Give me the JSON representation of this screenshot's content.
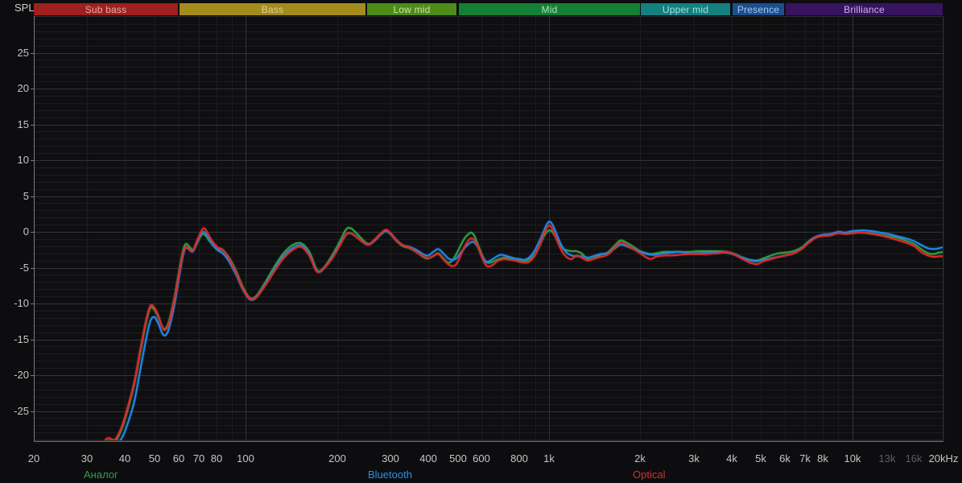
{
  "header": {
    "spl_label": "SPL"
  },
  "bands": [
    {
      "label": "Sub bass",
      "f_start": 20,
      "f_end": 60,
      "color": "#a01f1f",
      "text_color": "#e4b2ad"
    },
    {
      "label": "Bass",
      "f_start": 60,
      "f_end": 250,
      "color": "#a38c1c",
      "text_color": "#ded29b"
    },
    {
      "label": "Low mid",
      "f_start": 250,
      "f_end": 500,
      "color": "#4e8c18",
      "text_color": "#cfe3a8"
    },
    {
      "label": "Mid",
      "f_start": 500,
      "f_end": 2000,
      "color": "#148035",
      "text_color": "#b5dfc2"
    },
    {
      "label": "Upper mid",
      "f_start": 2000,
      "f_end": 4000,
      "color": "#148080",
      "text_color": "#abdcdc"
    },
    {
      "label": "Presence",
      "f_start": 4000,
      "f_end": 6000,
      "color": "#1b4f8f",
      "text_color": "#aac7e9"
    },
    {
      "label": "Brilliance",
      "f_start": 6000,
      "f_end": 20000,
      "color": "#38135f",
      "text_color": "#c9b3e4"
    }
  ],
  "axes": {
    "y_unit": "dB",
    "y_ticks": [
      25,
      20,
      15,
      10,
      5,
      0,
      -5,
      -10,
      -15,
      -20,
      -25
    ],
    "x_ticks": [
      {
        "f": 20,
        "label": "20"
      },
      {
        "f": 30,
        "label": "30"
      },
      {
        "f": 40,
        "label": "40"
      },
      {
        "f": 50,
        "label": "50"
      },
      {
        "f": 60,
        "label": "60"
      },
      {
        "f": 70,
        "label": "70"
      },
      {
        "f": 80,
        "label": "80"
      },
      {
        "f": 100,
        "label": "100"
      },
      {
        "f": 200,
        "label": "200"
      },
      {
        "f": 300,
        "label": "300"
      },
      {
        "f": 400,
        "label": "400"
      },
      {
        "f": 500,
        "label": "500"
      },
      {
        "f": 600,
        "label": "600"
      },
      {
        "f": 800,
        "label": "800"
      },
      {
        "f": 1000,
        "label": "1k"
      },
      {
        "f": 2000,
        "label": "2k"
      },
      {
        "f": 3000,
        "label": "3k"
      },
      {
        "f": 4000,
        "label": "4k"
      },
      {
        "f": 5000,
        "label": "5k"
      },
      {
        "f": 6000,
        "label": "6k"
      },
      {
        "f": 7000,
        "label": "7k"
      },
      {
        "f": 8000,
        "label": "8k"
      },
      {
        "f": 10000,
        "label": "10k"
      },
      {
        "f": 13000,
        "label": "13k",
        "dim": true
      },
      {
        "f": 16000,
        "label": "16k",
        "dim": true
      },
      {
        "f": 20000,
        "label": "20kHz"
      }
    ]
  },
  "legend": [
    {
      "label": "Аналог",
      "color": "#33a03e"
    },
    {
      "label": "Bluetooth",
      "color": "#2b8fe8"
    },
    {
      "label": "Optical",
      "color": "#d3302f"
    }
  ],
  "chart_data": {
    "type": "line",
    "title": "",
    "ylabel": "SPL (dB)",
    "x_unit": "Hz",
    "xscale": "log",
    "xlim": [
      20,
      20000
    ],
    "ylim": [
      -29.3,
      29.5
    ],
    "grid": true,
    "legend_position": "bottom",
    "x": [
      33,
      35,
      37,
      39,
      41,
      43,
      45,
      47,
      48.5,
      50,
      51.5,
      53.5,
      55.5,
      58,
      60,
      62,
      63.5,
      65.5,
      67,
      69,
      71,
      72.5,
      74,
      76,
      78.5,
      81,
      84,
      88,
      93,
      98,
      103,
      108,
      115,
      123,
      132,
      142,
      152,
      162,
      170,
      175,
      182,
      192,
      203,
      214,
      222,
      232,
      243,
      254,
      266,
      278,
      290,
      302,
      315,
      330,
      348,
      368,
      388,
      400,
      418,
      432,
      448,
      465,
      480,
      495,
      510,
      525,
      540,
      555,
      568,
      582,
      598,
      612,
      626,
      640,
      658,
      675,
      695,
      715,
      740,
      770,
      800,
      830,
      860,
      895,
      925,
      955,
      980,
      1000,
      1020,
      1045,
      1075,
      1110,
      1150,
      1190,
      1230,
      1280,
      1340,
      1400,
      1480,
      1560,
      1650,
      1720,
      1800,
      1900,
      2000,
      2100,
      2170,
      2250,
      2400,
      2550,
      2700,
      2900,
      3100,
      3300,
      3600,
      3850,
      4100,
      4350,
      4600,
      4850,
      5100,
      5400,
      5700,
      6000,
      6400,
      6800,
      7200,
      7600,
      8000,
      8500,
      9000,
      9500,
      10000,
      10800,
      11600,
      12400,
      13200,
      14000,
      15000,
      16000,
      17000,
      17800,
      18600,
      19300,
      20000
    ],
    "series": [
      {
        "name": "Аналог",
        "color": "#2da03c",
        "values": [
          -31,
          -29.2,
          -29.3,
          -27.5,
          -24.5,
          -21,
          -16.5,
          -12.5,
          -10.6,
          -10.9,
          -11.9,
          -13.5,
          -12.8,
          -9.5,
          -6.0,
          -2.8,
          -1.7,
          -2.2,
          -2.5,
          -1.6,
          -0.6,
          -0.3,
          -0.6,
          -1.3,
          -2.0,
          -2.4,
          -2.6,
          -3.6,
          -5.5,
          -7.8,
          -9.2,
          -9.0,
          -7.3,
          -5.2,
          -3.2,
          -1.9,
          -1.6,
          -2.8,
          -5.0,
          -5.5,
          -4.9,
          -3.4,
          -1.6,
          0.3,
          0.5,
          -0.2,
          -1.1,
          -1.7,
          -1.2,
          -0.4,
          0.2,
          -0.4,
          -1.3,
          -2.0,
          -2.3,
          -2.9,
          -3.6,
          -3.7,
          -3.3,
          -3.0,
          -3.7,
          -4.3,
          -4.0,
          -3.1,
          -2.0,
          -1.0,
          -0.4,
          -0.1,
          -0.6,
          -1.7,
          -3.0,
          -3.9,
          -4.3,
          -4.3,
          -4.1,
          -3.9,
          -3.7,
          -3.6,
          -3.7,
          -3.9,
          -4.0,
          -4.1,
          -3.9,
          -3.2,
          -2.2,
          -0.9,
          -0.1,
          0.2,
          0.1,
          -0.5,
          -1.4,
          -2.3,
          -2.6,
          -2.7,
          -2.7,
          -3.0,
          -3.8,
          -3.7,
          -3.2,
          -2.9,
          -1.9,
          -1.2,
          -1.5,
          -2.1,
          -2.7,
          -3.0,
          -3.1,
          -3.0,
          -2.8,
          -2.8,
          -2.8,
          -2.8,
          -2.7,
          -2.7,
          -2.7,
          -2.8,
          -3.1,
          -3.6,
          -3.9,
          -4.0,
          -3.7,
          -3.3,
          -3.0,
          -2.9,
          -2.7,
          -2.2,
          -1.3,
          -0.7,
          -0.5,
          -0.4,
          -0.1,
          -0.2,
          -0.1,
          -0.1,
          -0.2,
          -0.4,
          -0.6,
          -0.8,
          -1.2,
          -1.7,
          -2.5,
          -3.0,
          -3.1,
          -2.9,
          -2.8
        ]
      },
      {
        "name": "Bluetooth",
        "color": "#1f87e8",
        "values": [
          -32,
          -31,
          -29.8,
          -28.8,
          -26.5,
          -23.5,
          -19,
          -14.8,
          -12.4,
          -11.9,
          -12.8,
          -14.4,
          -13.8,
          -10.5,
          -6.8,
          -3.4,
          -2.2,
          -2.6,
          -2.7,
          -1.5,
          -0.4,
          0.0,
          -0.3,
          -1.1,
          -2.0,
          -2.6,
          -3.0,
          -4.1,
          -6.0,
          -8.1,
          -9.4,
          -9.2,
          -7.6,
          -5.6,
          -3.6,
          -2.3,
          -1.9,
          -3.1,
          -5.2,
          -5.6,
          -5.0,
          -3.7,
          -2.0,
          -0.4,
          -0.2,
          -0.7,
          -1.4,
          -1.8,
          -1.2,
          -0.4,
          0.1,
          -0.4,
          -1.2,
          -1.9,
          -2.1,
          -2.6,
          -3.2,
          -3.3,
          -2.7,
          -2.4,
          -3.0,
          -3.7,
          -3.9,
          -3.7,
          -3.0,
          -2.3,
          -1.8,
          -1.4,
          -1.5,
          -2.1,
          -3.1,
          -3.9,
          -4.2,
          -4.0,
          -3.7,
          -3.4,
          -3.2,
          -3.3,
          -3.5,
          -3.7,
          -3.8,
          -3.9,
          -3.6,
          -2.7,
          -1.5,
          -0.2,
          0.9,
          1.4,
          1.2,
          0.3,
          -1.0,
          -2.2,
          -3.0,
          -3.3,
          -3.4,
          -3.4,
          -3.6,
          -3.4,
          -3.1,
          -3.0,
          -2.3,
          -1.8,
          -2.0,
          -2.4,
          -2.8,
          -3.1,
          -3.2,
          -3.2,
          -3.0,
          -2.9,
          -2.8,
          -3.0,
          -3.0,
          -2.9,
          -2.9,
          -2.9,
          -3.2,
          -3.6,
          -4.0,
          -4.1,
          -3.9,
          -3.7,
          -3.5,
          -3.3,
          -3.0,
          -2.4,
          -1.4,
          -0.7,
          -0.4,
          -0.3,
          0.0,
          -0.1,
          0.1,
          0.2,
          0.1,
          -0.1,
          -0.3,
          -0.6,
          -0.9,
          -1.3,
          -1.9,
          -2.3,
          -2.4,
          -2.3,
          -2.1
        ]
      },
      {
        "name": "Optical",
        "color": "#da2a2a",
        "values": [
          -30.2,
          -28.8,
          -29.0,
          -27.2,
          -24.2,
          -20.8,
          -16.2,
          -12.2,
          -10.3,
          -10.6,
          -11.7,
          -13.6,
          -13.0,
          -9.8,
          -6.3,
          -3.1,
          -2.1,
          -2.5,
          -2.6,
          -1.3,
          -0.1,
          0.5,
          0.2,
          -0.7,
          -1.6,
          -2.2,
          -2.5,
          -3.7,
          -5.7,
          -8.0,
          -9.3,
          -9.2,
          -7.7,
          -5.8,
          -3.9,
          -2.6,
          -2.1,
          -3.3,
          -5.3,
          -5.6,
          -5.0,
          -3.8,
          -2.1,
          -0.4,
          -0.2,
          -0.7,
          -1.4,
          -1.8,
          -1.1,
          -0.3,
          0.3,
          -0.3,
          -1.2,
          -1.9,
          -2.2,
          -2.9,
          -3.5,
          -3.7,
          -3.3,
          -3.1,
          -3.8,
          -4.5,
          -4.8,
          -4.5,
          -3.4,
          -2.2,
          -1.3,
          -0.9,
          -1.2,
          -2.0,
          -3.3,
          -4.3,
          -4.8,
          -4.8,
          -4.5,
          -4.1,
          -3.9,
          -3.8,
          -3.9,
          -4.0,
          -4.2,
          -4.3,
          -4.2,
          -3.4,
          -2.2,
          -0.7,
          0.4,
          0.9,
          0.6,
          -0.4,
          -1.7,
          -2.9,
          -3.6,
          -3.8,
          -3.3,
          -3.6,
          -4.0,
          -3.8,
          -3.5,
          -3.2,
          -2.2,
          -1.5,
          -1.8,
          -2.4,
          -3.0,
          -3.6,
          -3.8,
          -3.5,
          -3.3,
          -3.3,
          -3.2,
          -3.1,
          -3.1,
          -3.1,
          -3.0,
          -2.8,
          -3.2,
          -3.8,
          -4.3,
          -4.5,
          -4.1,
          -3.8,
          -3.5,
          -3.3,
          -3.0,
          -2.4,
          -1.5,
          -0.8,
          -0.6,
          -0.5,
          -0.2,
          -0.3,
          -0.2,
          -0.1,
          -0.3,
          -0.5,
          -0.8,
          -1.1,
          -1.5,
          -2.0,
          -2.9,
          -3.3,
          -3.5,
          -3.4,
          -3.4
        ]
      }
    ]
  }
}
